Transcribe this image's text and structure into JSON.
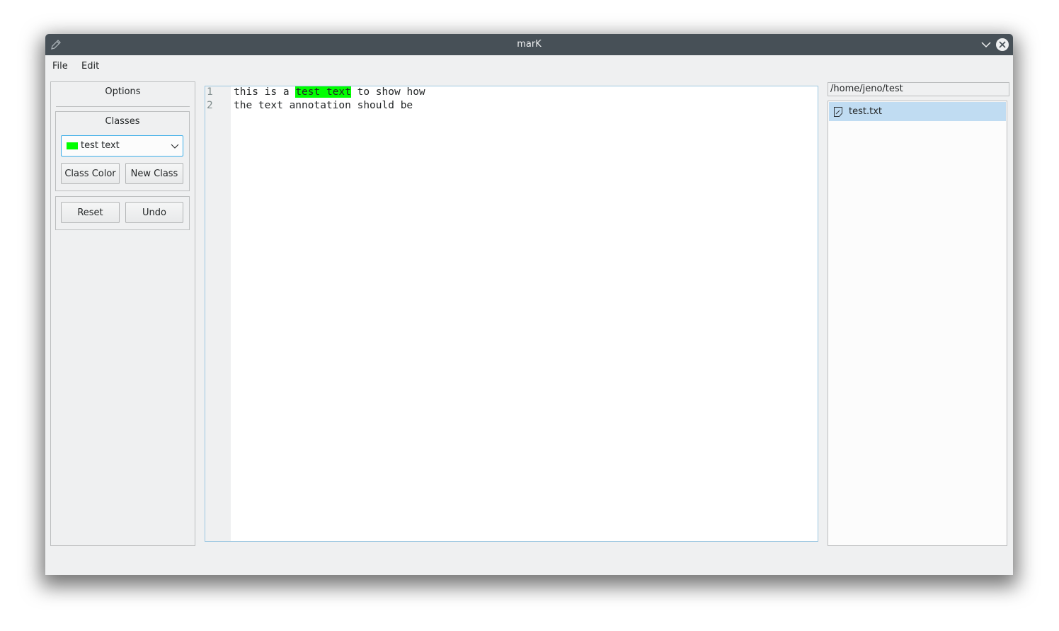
{
  "window": {
    "title": "marK"
  },
  "menubar": {
    "items": [
      "File",
      "Edit"
    ]
  },
  "options": {
    "title": "Options",
    "classes": {
      "title": "Classes",
      "selected": {
        "label": "test text",
        "color": "#00ff00"
      },
      "class_color_label": "Class Color",
      "new_class_label": "New Class"
    },
    "reset_label": "Reset",
    "undo_label": "Undo"
  },
  "editor": {
    "lines": [
      {
        "number": "1",
        "before": "this is a ",
        "highlight": "test text",
        "after": " to show how"
      },
      {
        "number": "2",
        "before": "the text annotation should be",
        "highlight": "",
        "after": ""
      }
    ],
    "highlight_color": "#00ff00"
  },
  "files": {
    "path": "/home/jeno/test",
    "items": [
      {
        "name": "test.txt",
        "selected": true
      }
    ]
  }
}
